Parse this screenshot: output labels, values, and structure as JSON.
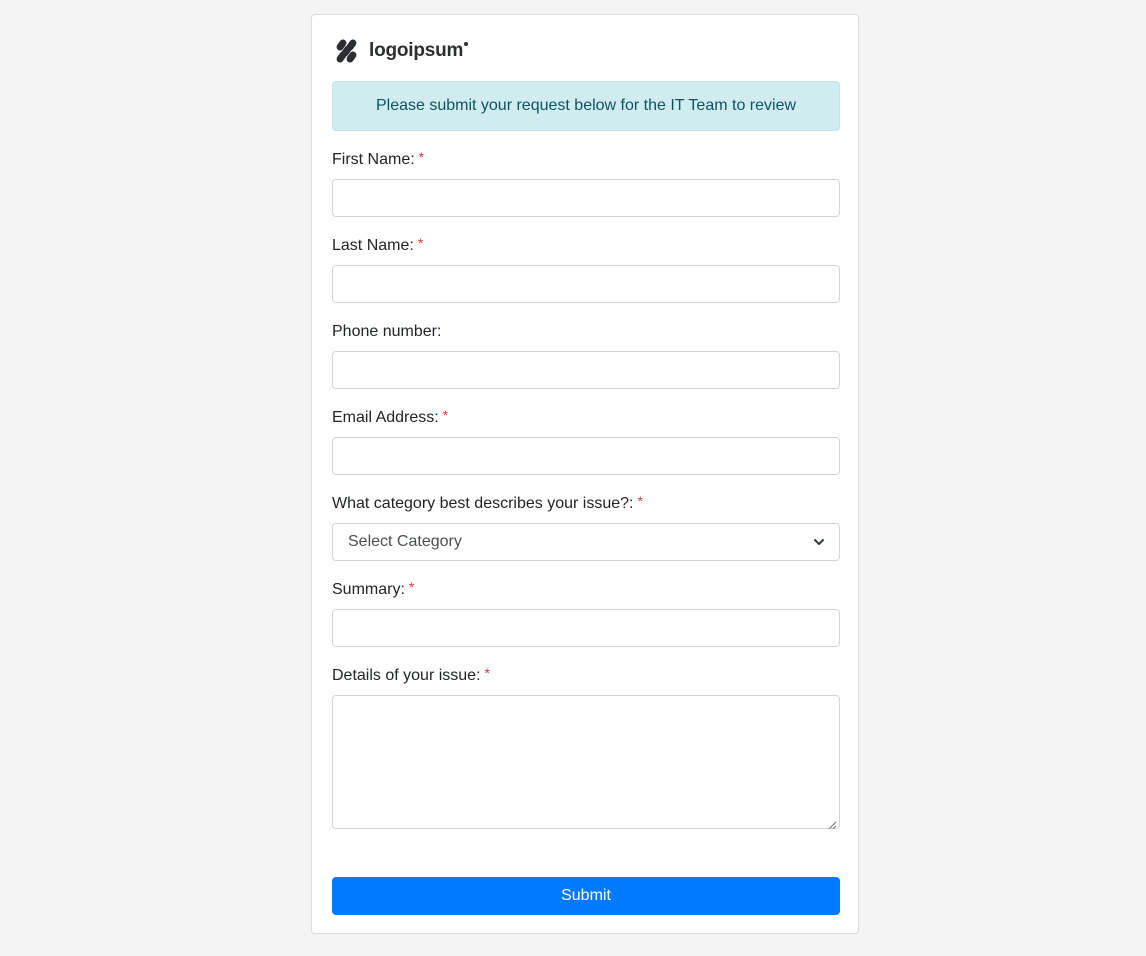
{
  "logo": {
    "text": "logoipsum",
    "icon": "logo-mark-icon"
  },
  "alert": {
    "text": "Please submit your request below for the IT Team to review"
  },
  "required_marker": "*",
  "fields": {
    "first_name": {
      "label": "First Name:",
      "required": true,
      "value": ""
    },
    "last_name": {
      "label": "Last Name:",
      "required": true,
      "value": ""
    },
    "phone": {
      "label": "Phone number:",
      "required": false,
      "value": ""
    },
    "email": {
      "label": "Email Address:",
      "required": true,
      "value": ""
    },
    "category": {
      "label": "What category best describes your issue?:",
      "required": true,
      "selected": "Select Category",
      "icon": "chevron-down-icon"
    },
    "summary": {
      "label": "Summary:",
      "required": true,
      "value": ""
    },
    "details": {
      "label": "Details of your issue:",
      "required": true,
      "value": ""
    }
  },
  "submit": {
    "label": "Submit"
  },
  "colors": {
    "background": "#f4f4f4",
    "alert_bg": "#d1ecf1",
    "alert_text": "#0c5460",
    "required": "#dc3545",
    "primary": "#007bff"
  }
}
